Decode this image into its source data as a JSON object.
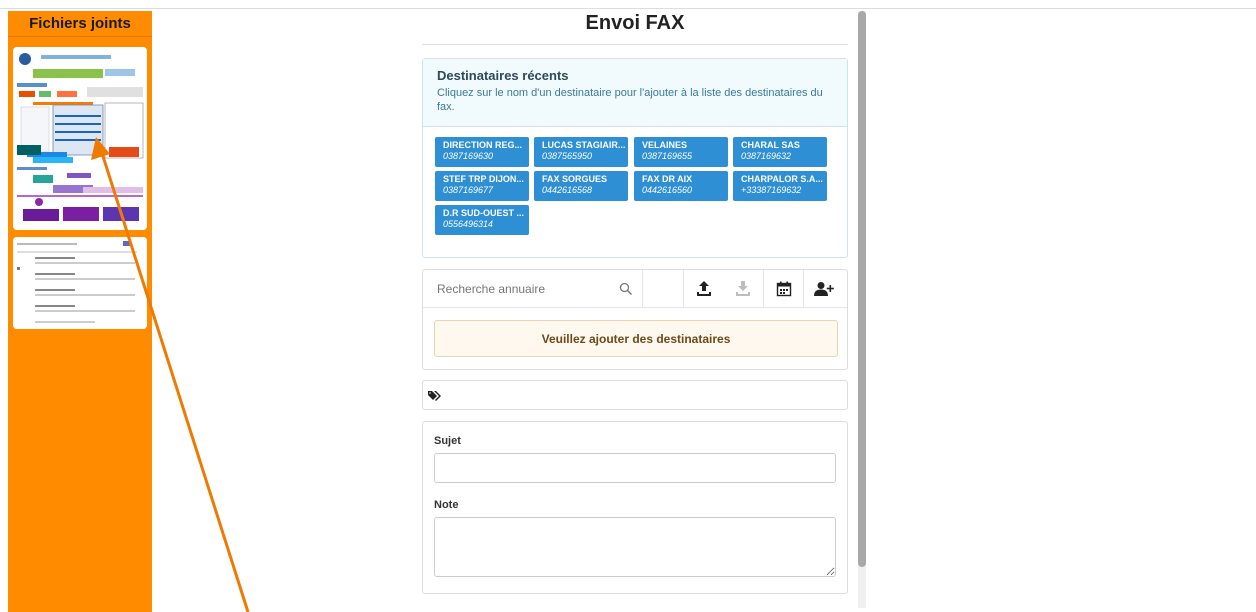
{
  "sidebar": {
    "title": "Fichiers joints"
  },
  "main": {
    "title": "Envoi FAX",
    "recent": {
      "heading": "Destinataires récents",
      "hint": "Cliquez sur le nom d'un destinataire pour l'ajouter à la liste des destinataires du fax.",
      "recipients": [
        {
          "name": "DIRECTION REG...",
          "phone": "0387169630"
        },
        {
          "name": "LUCAS STAGIAIR...",
          "phone": "0387565950"
        },
        {
          "name": "VELAINES",
          "phone": "0387169655"
        },
        {
          "name": "CHARAL SAS",
          "phone": "0387169632"
        },
        {
          "name": "STEF TRP DIJON...",
          "phone": "0387169677"
        },
        {
          "name": "FAX SORGUES",
          "phone": "0442616568"
        },
        {
          "name": "FAX DR AIX",
          "phone": "0442616560"
        },
        {
          "name": "CHARPALOR S.A...",
          "phone": "+33387169632"
        },
        {
          "name": "D.R SUD-OUEST ...",
          "phone": "0556496314"
        }
      ]
    },
    "directory": {
      "search_placeholder": "Recherche annuaire",
      "warning": "Veuillez ajouter des destinataires"
    },
    "form": {
      "subject_label": "Sujet",
      "note_label": "Note"
    }
  },
  "colors": {
    "sidebar_bg": "#ff8c00",
    "recipient_button": "#2f8fd5",
    "annotation_arrow": "#f07a00"
  },
  "icons": [
    "search-icon",
    "upload-icon",
    "download-icon",
    "calendar-icon",
    "add-user-icon",
    "tags-icon"
  ]
}
